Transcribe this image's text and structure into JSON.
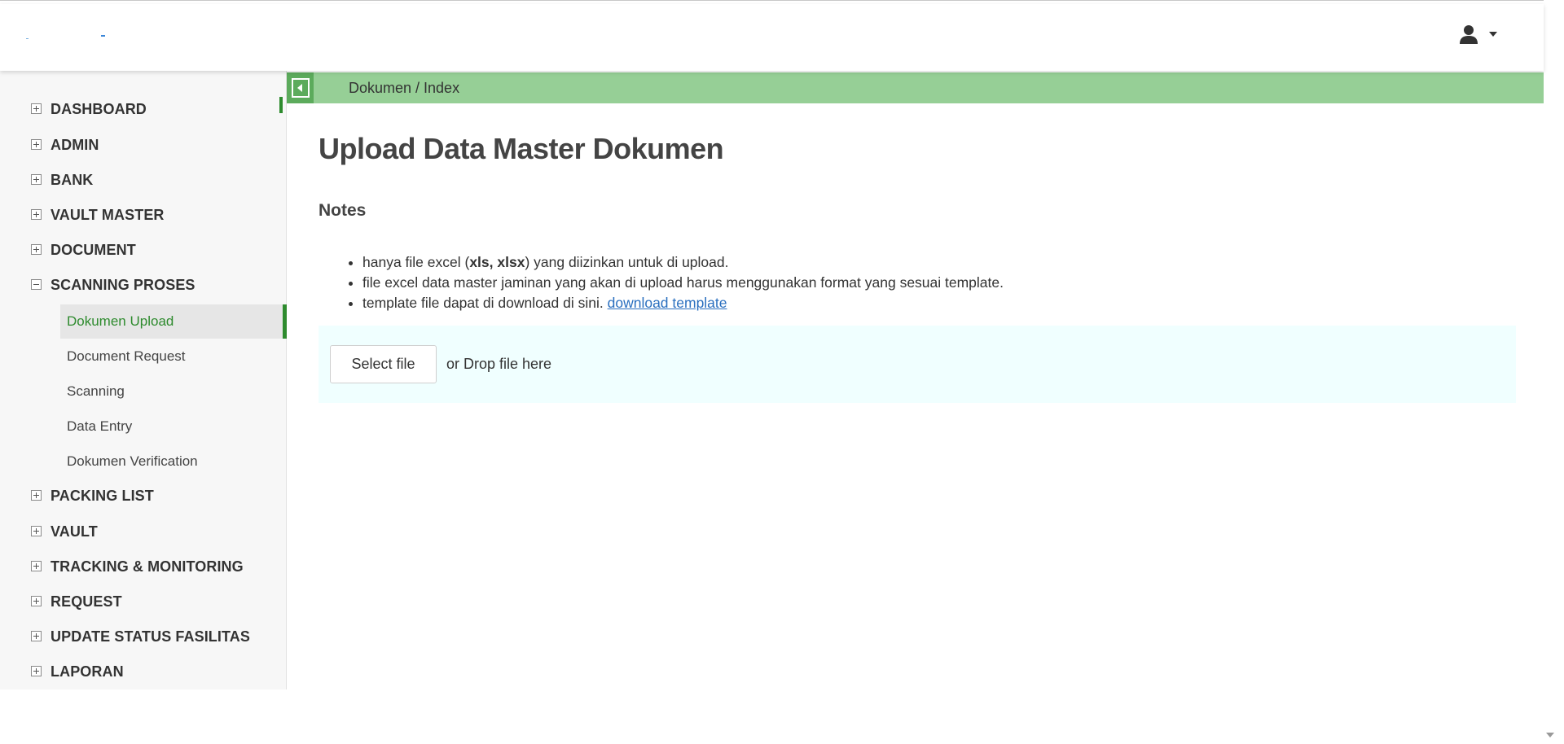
{
  "header": {
    "user_icon": "user-icon",
    "caret_icon": "caret-down-icon"
  },
  "sidebar": {
    "expanded_icon": "minus-square-icon",
    "collapsed_icon": "plus-square-icon",
    "sections": [
      {
        "label": "DASHBOARD",
        "expanded": false
      },
      {
        "label": "ADMIN",
        "expanded": false
      },
      {
        "label": "BANK",
        "expanded": false
      },
      {
        "label": "VAULT MASTER",
        "expanded": false
      },
      {
        "label": "DOCUMENT",
        "expanded": false
      },
      {
        "label": "SCANNING PROSES",
        "expanded": true
      },
      {
        "label": "PACKING LIST",
        "expanded": false
      },
      {
        "label": "VAULT",
        "expanded": false
      },
      {
        "label": "TRACKING & MONITORING",
        "expanded": false
      },
      {
        "label": "REQUEST",
        "expanded": false
      },
      {
        "label": "UPDATE STATUS FASILITAS",
        "expanded": false
      },
      {
        "label": "LAPORAN",
        "expanded": false
      }
    ],
    "sub_items": [
      {
        "label": "Dokumen Upload",
        "active": true
      },
      {
        "label": "Document Request",
        "active": false
      },
      {
        "label": "Scanning",
        "active": false
      },
      {
        "label": "Data Entry",
        "active": false
      },
      {
        "label": "Dokumen Verification",
        "active": false
      }
    ]
  },
  "breadcrumb": {
    "text": "Dokumen / Index",
    "collapse_icon": "sidebar-collapse-icon"
  },
  "main": {
    "title": "Upload Data Master Dokumen",
    "notes_title": "Notes",
    "notes": {
      "n1_pre": "hanya file excel (",
      "n1_bold": "xls, xlsx",
      "n1_post": ") yang diizinkan untuk di upload.",
      "n2": "file excel data master jaminan yang akan di upload harus menggunakan format yang sesuai template.",
      "n3_pre": "template file dapat di download di sini. ",
      "n3_link": "download template"
    },
    "upload": {
      "button_label": "Select file",
      "drop_text": "or Drop file here"
    }
  },
  "colors": {
    "accent_green": "#2e8b2e",
    "breadcrumb_bg": "#96cf96",
    "drop_zone_bg": "#f0ffff",
    "link": "#2a6fbf"
  }
}
